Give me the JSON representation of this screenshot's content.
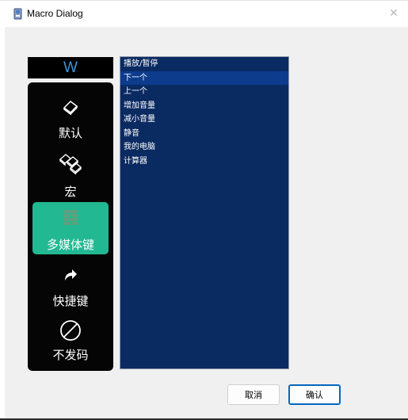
{
  "window": {
    "title": "Macro Dialog",
    "close_glyph": "✕"
  },
  "key_indicator": {
    "value": "W"
  },
  "side_nav": {
    "items": [
      {
        "label": "默认",
        "icon": "keycap-icon",
        "active": false
      },
      {
        "label": "宏",
        "icon": "keycaps-cluster-icon",
        "active": false
      },
      {
        "label": "多媒体键",
        "icon": "media-grid-icon",
        "active": true
      },
      {
        "label": "快捷键",
        "icon": "shortcut-arrow-icon",
        "active": false
      },
      {
        "label": "不发码",
        "icon": "prohibited-icon",
        "active": false
      }
    ]
  },
  "media_list": {
    "items": [
      "播放/暂停",
      "下一个",
      "上一个",
      "增加音量",
      "减小音量",
      "静音",
      "我的电脑",
      "计算器"
    ],
    "selected_index": 1
  },
  "buttons": {
    "cancel": "取消",
    "confirm": "确认"
  },
  "colors": {
    "accent": "#22b892",
    "list_bg": "#0a2a62",
    "list_selected": "#0d3c8c",
    "indicator_text": "#3d93d6"
  }
}
